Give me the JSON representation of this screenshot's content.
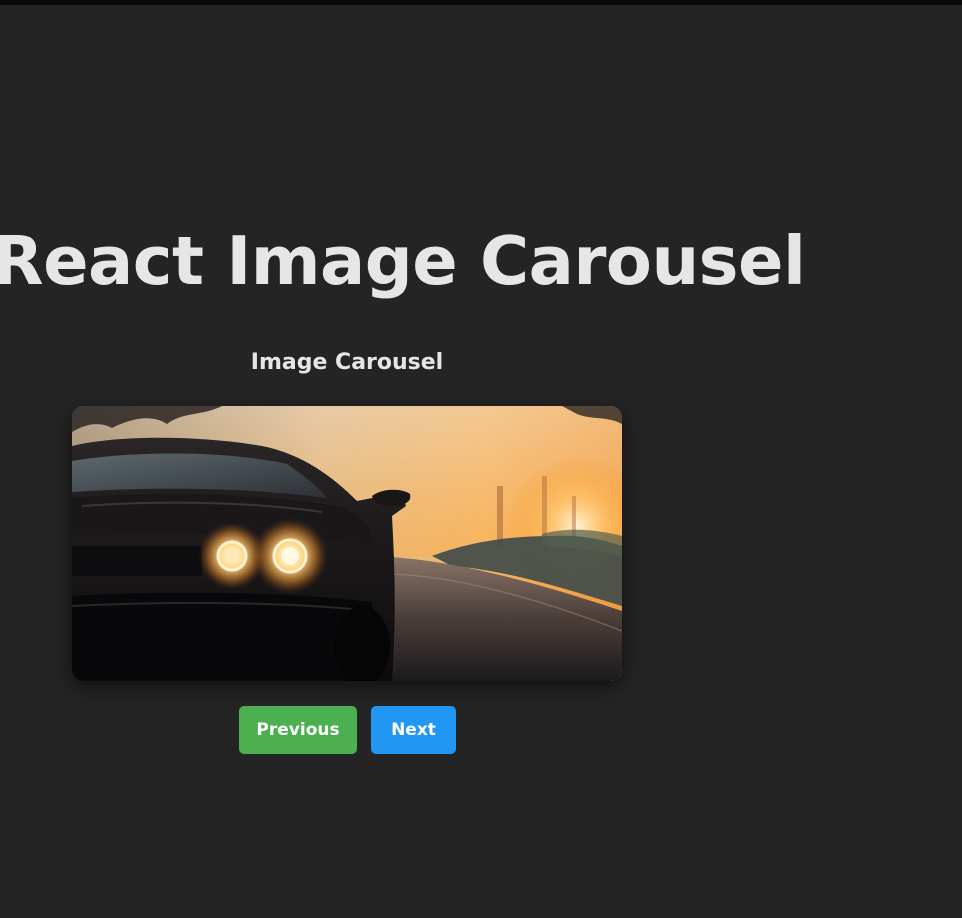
{
  "page": {
    "title": "React Image Carousel"
  },
  "carousel": {
    "heading": "Image Carousel",
    "image": {
      "icon": "car-at-sunset-photo"
    },
    "previous_label": "Previous",
    "next_label": "Next"
  },
  "colors": {
    "background": "#242424",
    "text": "#e6e6e6",
    "previous_button": "#4caf50",
    "next_button": "#2196f3"
  }
}
